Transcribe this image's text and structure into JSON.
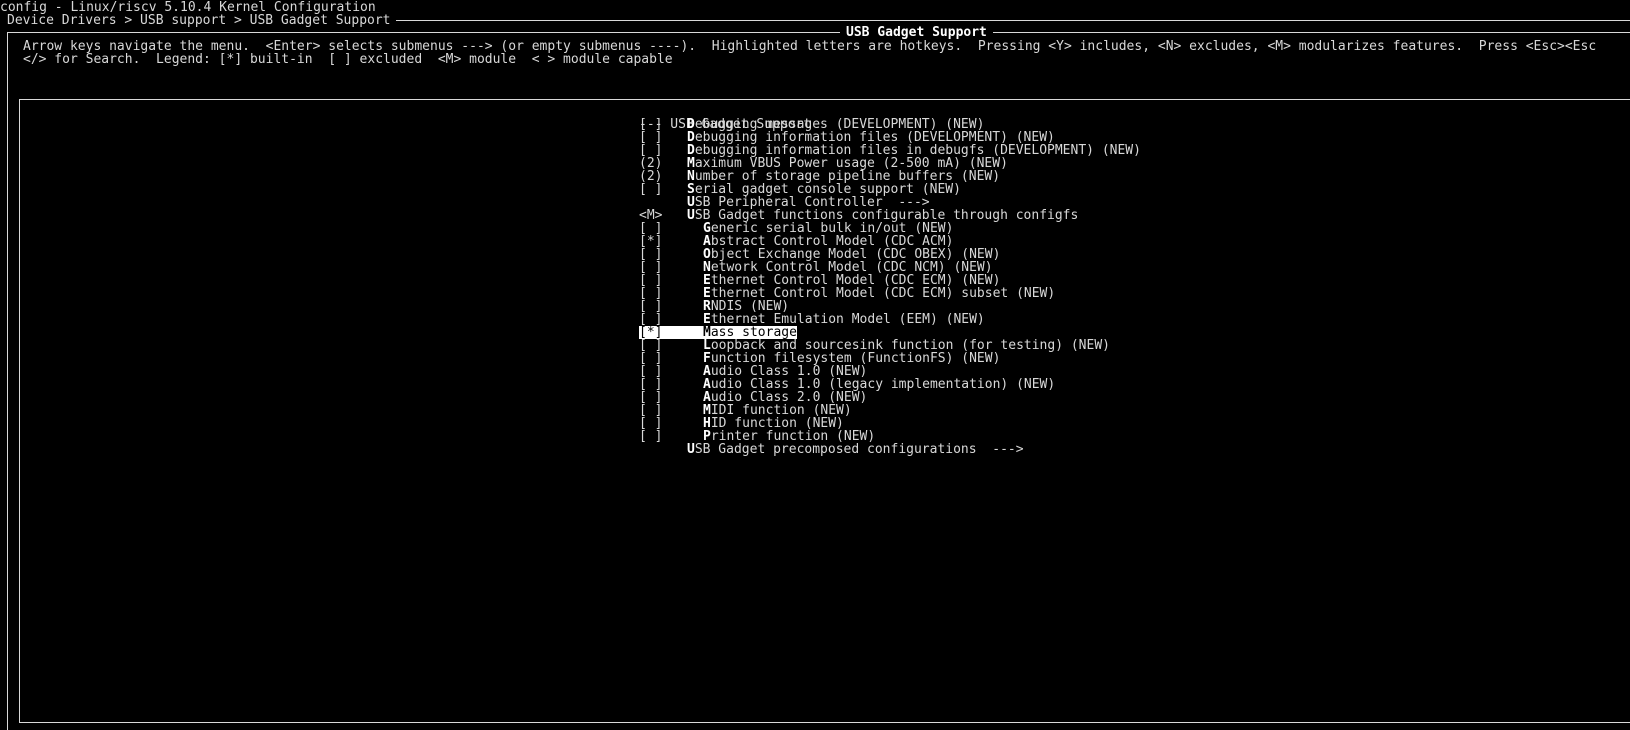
{
  "window": {
    "title": "config - Linux/riscv 5.10.4 Kernel Configuration",
    "breadcrumb": "Device Drivers > USB support > USB Gadget Support"
  },
  "dialog": {
    "title": "USB Gadget Support",
    "help_line1": "Arrow keys navigate the menu.  <Enter> selects submenus ---> (or empty submenus ----).  Highlighted letters are hotkeys.  Pressing <Y> includes, <N> excludes, <M> modularizes features.  Press <Esc><Esc",
    "help_line2": "</> for Search.  Legend: [*] built-in  [ ] excluded  <M> module  < > module capable"
  },
  "menu": {
    "heading": "--- USB Gadget Support",
    "items": [
      {
        "status": "[ ]",
        "hotkey": "D",
        "rest": "ebugging messages (DEVELOPMENT) (NEW)",
        "level": 0
      },
      {
        "status": "[ ]",
        "hotkey": "D",
        "rest": "ebugging information files (DEVELOPMENT) (NEW)",
        "level": 0
      },
      {
        "status": "[ ]",
        "hotkey": "D",
        "rest": "ebugging information files in debugfs (DEVELOPMENT) (NEW)",
        "level": 0
      },
      {
        "status": "(2)",
        "hotkey": "M",
        "rest": "aximum VBUS Power usage (2-500 mA) (NEW)",
        "level": 0
      },
      {
        "status": "(2)",
        "hotkey": "N",
        "rest": "umber of storage pipeline buffers (NEW)",
        "level": 0
      },
      {
        "status": "[ ]",
        "hotkey": "S",
        "rest": "erial gadget console support (NEW)",
        "level": 0
      },
      {
        "status": "",
        "hotkey": "U",
        "rest": "SB Peripheral Controller  --->",
        "level": 0
      },
      {
        "status": "<M>",
        "hotkey": "U",
        "rest": "SB Gadget functions configurable through configfs",
        "level": 0
      },
      {
        "status": "[ ]",
        "hotkey": "G",
        "rest": "eneric serial bulk in/out (NEW)",
        "level": 1
      },
      {
        "status": "[*]",
        "hotkey": "A",
        "rest": "bstract Control Model (CDC ACM)",
        "level": 1
      },
      {
        "status": "[ ]",
        "hotkey": "O",
        "rest": "bject Exchange Model (CDC OBEX) (NEW)",
        "level": 1
      },
      {
        "status": "[ ]",
        "hotkey": "N",
        "rest": "etwork Control Model (CDC NCM) (NEW)",
        "level": 1
      },
      {
        "status": "[ ]",
        "hotkey": "E",
        "rest": "thernet Control Model (CDC ECM) (NEW)",
        "level": 1
      },
      {
        "status": "[ ]",
        "hotkey": "E",
        "rest": "thernet Control Model (CDC ECM) subset (NEW)",
        "level": 1
      },
      {
        "status": "[ ]",
        "hotkey": "R",
        "rest": "NDIS (NEW)",
        "level": 1
      },
      {
        "status": "[ ]",
        "hotkey": "E",
        "rest": "thernet Emulation Model (EEM) (NEW)",
        "level": 1
      },
      {
        "status": "[*]",
        "hotkey": "M",
        "rest": "ass storage",
        "level": 1,
        "selected": true
      },
      {
        "status": "[ ]",
        "hotkey": "L",
        "rest": "oopback and sourcesink function (for testing) (NEW)",
        "level": 1
      },
      {
        "status": "[ ]",
        "hotkey": "F",
        "rest": "unction filesystem (FunctionFS) (NEW)",
        "level": 1
      },
      {
        "status": "[ ]",
        "hotkey": "A",
        "rest": "udio Class 1.0 (NEW)",
        "level": 1
      },
      {
        "status": "[ ]",
        "hotkey": "A",
        "rest": "udio Class 1.0 (legacy implementation) (NEW)",
        "level": 1
      },
      {
        "status": "[ ]",
        "hotkey": "A",
        "rest": "udio Class 2.0 (NEW)",
        "level": 1
      },
      {
        "status": "[ ]",
        "hotkey": "M",
        "rest": "IDI function (NEW)",
        "level": 1
      },
      {
        "status": "[ ]",
        "hotkey": "H",
        "rest": "ID function (NEW)",
        "level": 1
      },
      {
        "status": "[ ]",
        "hotkey": "P",
        "rest": "rinter function (NEW)",
        "level": 1
      },
      {
        "status": "",
        "hotkey": "U",
        "rest": "SB Gadget precomposed configurations  --->",
        "level": 0
      }
    ]
  }
}
